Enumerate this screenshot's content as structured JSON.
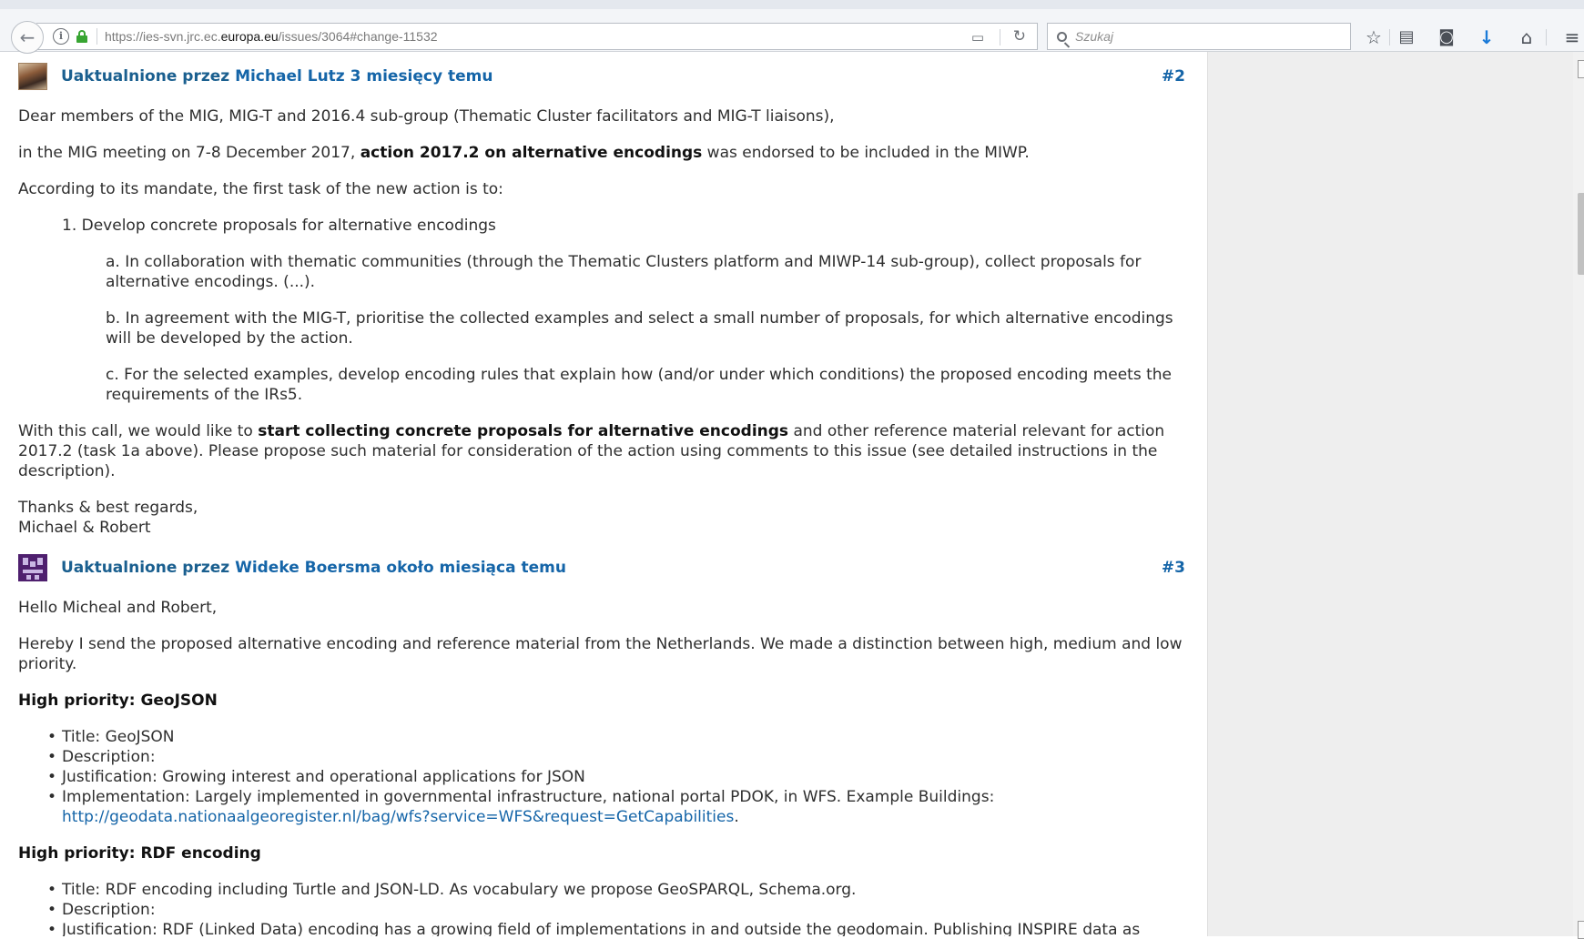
{
  "browser": {
    "url_prefix": "https://ies-svn.jrc.ec.",
    "url_domain": "europa.eu",
    "url_path": "/issues/3064#change-11532",
    "search_placeholder": "Szukaj"
  },
  "journals": [
    {
      "prefix": "Uaktualnione przez",
      "author": "Michael Lutz",
      "when": "3 miesięcy temu",
      "number": "#2",
      "intro": "Dear members of the MIG, MIG-T and 2016.4 sub-group (Thematic Cluster facilitators and MIG-T liaisons),",
      "meeting_pre": "in the MIG meeting on 7-8 December 2017, ",
      "meeting_bold": "action 2017.2 on alternative encodings",
      "meeting_post": " was endorsed to be included in the MIWP.",
      "mandate": "According to its mandate, the first task of the new action is to:",
      "task": "1. Develop concrete proposals for alternative encodings",
      "sub_a": "a. In collaboration with thematic communities (through the Thematic Clusters platform and MIWP-14 sub-group), collect proposals for alternative encodings. (...).",
      "sub_b": "b. In agreement with the MIG-T, prioritise the collected examples and select a small number of proposals, for which alternative encodings will be developed by the action.",
      "sub_c": "c. For the selected examples, develop encoding rules that explain how (and/or under which conditions) the proposed encoding meets the requirements of the IRs5.",
      "call_pre": "With this call, we would like to ",
      "call_bold": "start collecting concrete proposals for alternative encodings",
      "call_post": " and other reference material relevant for action 2017.2 (task 1a above). Please propose such material for consideration of the action using comments to this issue (see detailed instructions in the description).",
      "thanks": "Thanks & best regards,",
      "signature": "Michael & Robert"
    },
    {
      "prefix": "Uaktualnione przez",
      "author": "Wideke Boersma",
      "when": "około miesiąca temu",
      "number": "#3",
      "greeting": "Hello Micheal and Robert,",
      "hereby": "Hereby I send the proposed alternative encoding and reference material from the Netherlands. We made a distinction between high, medium and low priority.",
      "h1": "High priority: GeoJSON",
      "list1": [
        "Title: GeoJSON",
        "Description:",
        "Justification: Growing interest and operational applications for JSON"
      ],
      "impl_text": "Implementation: Largely implemented in governmental infrastructure, national portal PDOK, in WFS. Example Buildings:",
      "impl_link": "http://geodata.nationaalgeoregister.nl/bag/wfs?service=WFS&request=GetCapabilities",
      "impl_end": ".",
      "h2": "High priority: RDF encoding",
      "list2": [
        "Title: RDF encoding including Turtle and JSON-LD. As vocabulary we propose GeoSPARQL, Schema.org.",
        "Description:",
        "Justification: RDF (Linked Data) encoding has a growing field of implementations in and outside the geodomain. Publishing INSPIRE data as"
      ]
    }
  ]
}
